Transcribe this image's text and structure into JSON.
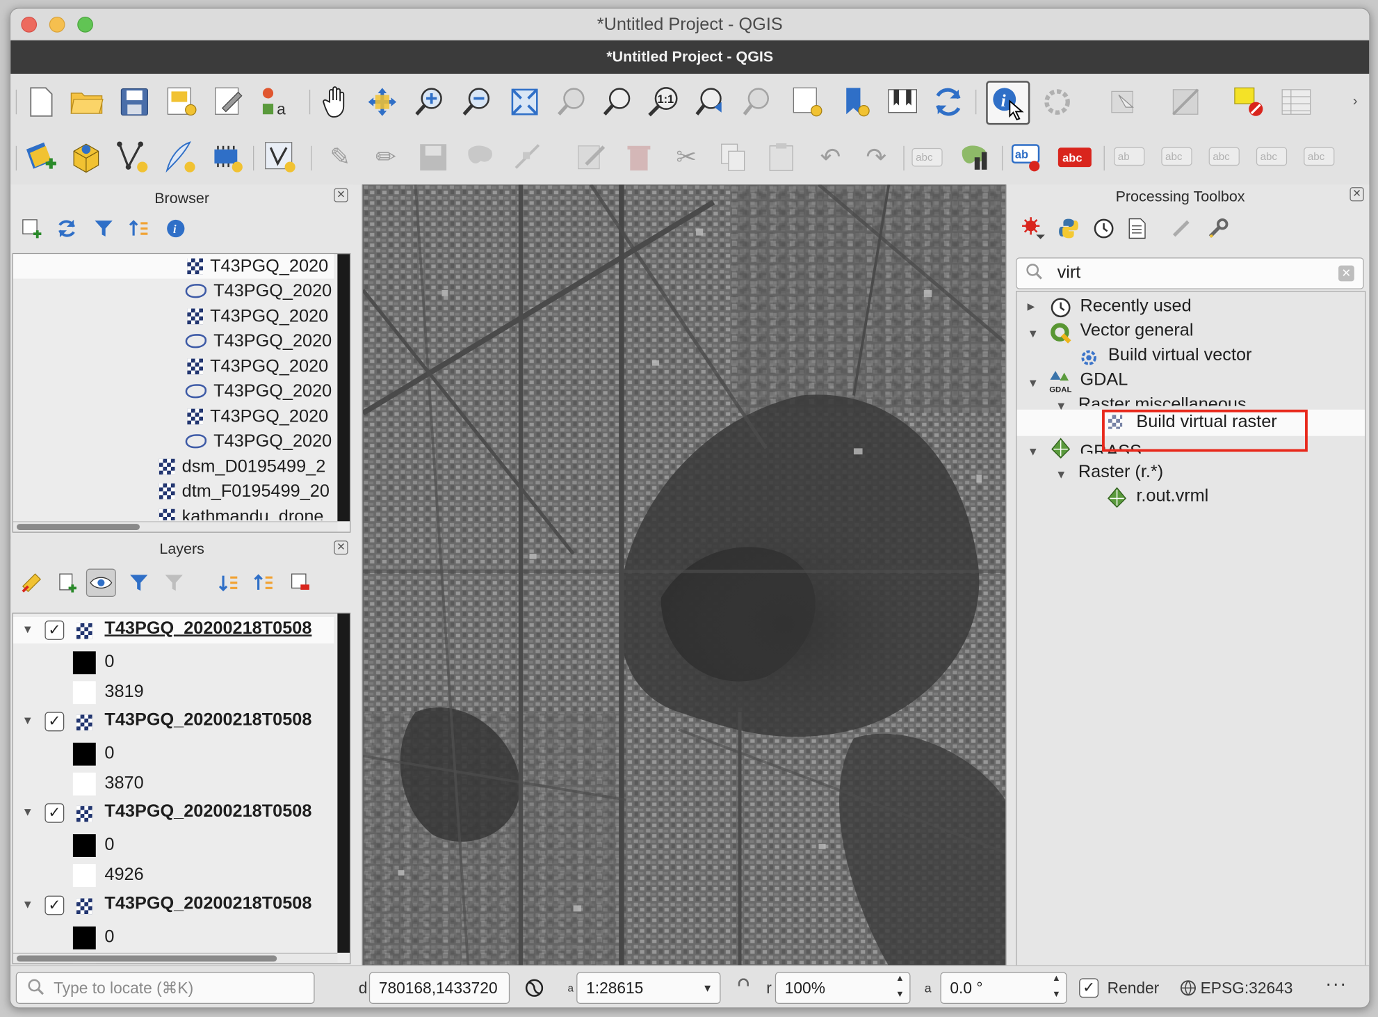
{
  "window": {
    "title": "*Untitled Project - QGIS",
    "document_title": "*Untitled Project - QGIS"
  },
  "browser_panel": {
    "title": "Browser",
    "items": [
      {
        "label": "T43PGQ_2020",
        "type": "raster",
        "selected": true
      },
      {
        "label": "T43PGQ_2020",
        "type": "vector"
      },
      {
        "label": "T43PGQ_2020",
        "type": "raster"
      },
      {
        "label": "T43PGQ_2020",
        "type": "vector"
      },
      {
        "label": "T43PGQ_2020",
        "type": "raster"
      },
      {
        "label": "T43PGQ_2020",
        "type": "vector"
      },
      {
        "label": "T43PGQ_2020",
        "type": "raster"
      },
      {
        "label": "T43PGQ_2020",
        "type": "vector"
      },
      {
        "label": "dsm_D0195499_2",
        "type": "raster"
      },
      {
        "label": "dtm_F0195499_20",
        "type": "raster"
      },
      {
        "label": "kathmandu_drone",
        "type": "raster"
      }
    ]
  },
  "layers_panel": {
    "title": "Layers",
    "layers": [
      {
        "name": "T43PGQ_20200218T0508",
        "checked": true,
        "min": "0",
        "max": "3819"
      },
      {
        "name": "T43PGQ_20200218T0508",
        "checked": true,
        "min": "0",
        "max": "3870"
      },
      {
        "name": "T43PGQ_20200218T0508",
        "checked": true,
        "min": "0",
        "max": "4926"
      },
      {
        "name": "T43PGQ_20200218T0508",
        "checked": true,
        "min": "0",
        "max": ""
      }
    ]
  },
  "toolbox": {
    "title": "Processing Toolbox",
    "search_value": "virt",
    "tree": {
      "recently_used": "Recently used",
      "vector_general": "Vector general",
      "build_virtual_vector": "Build virtual vector",
      "gdal": "GDAL",
      "raster_misc": "Raster miscellaneous",
      "build_virtual_raster": "Build virtual raster",
      "grass": "GRASS",
      "raster_r": "Raster (r.*)",
      "r_out_vrml": "r.out.vrml"
    }
  },
  "statusbar": {
    "locator_placeholder": "Type to locate (⌘K)",
    "coordinate_label": "d",
    "coordinate": "780168,1433720",
    "scale_label": "a",
    "scale": "1:28615",
    "magnifier_label": "r",
    "magnifier": "100%",
    "rotation_label": "a",
    "rotation": "0.0 °",
    "render_label": "Render",
    "render_checked": true,
    "crs": "EPSG:32643"
  },
  "icons": {
    "toolbar1": [
      "new-project-icon",
      "open-project-icon",
      "save-project-icon",
      "new-print-layout-icon",
      "layout-manager-icon",
      "style-manager-icon",
      "pan-icon",
      "pan-to-selection-icon",
      "zoom-in-icon",
      "zoom-out-icon",
      "zoom-full-icon",
      "zoom-to-selection-icon",
      "zoom-to-layer-icon",
      "zoom-native-icon",
      "zoom-last-icon",
      "zoom-next-icon",
      "new-map-view-icon",
      "new-bookmark-icon",
      "show-bookmarks-icon",
      "refresh-icon",
      "identify-icon",
      "action-icon",
      "select-icon",
      "deselect-icon",
      "attribute-table-icon"
    ],
    "accent_highlight": "#e8291c"
  }
}
